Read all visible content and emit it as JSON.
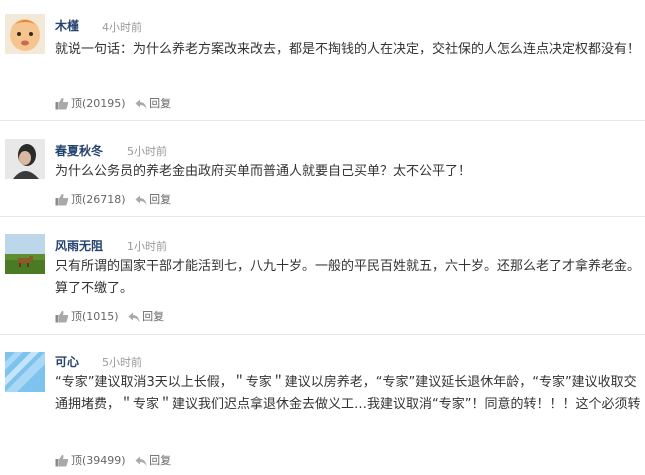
{
  "comments": [
    {
      "username": "木槿",
      "time": "4小时前",
      "text": "就说一句话：为什么养老方案改来改去，都是不掏钱的人在决定，交社保的人怎么连点决定权都没有！",
      "like_label": "顶",
      "like_count": "(20195)",
      "reply_label": "回复",
      "avatar_icon": "baby-face-avatar"
    },
    {
      "username": "春夏秋冬",
      "time": "5小时前",
      "text": "为什么公务员的养老金由政府买单而普通人就要自己买单？太不公平了！",
      "like_label": "顶",
      "like_count": "(26718)",
      "reply_label": "回复",
      "avatar_icon": "woman-photo-avatar"
    },
    {
      "username": "风雨无阻",
      "time": "1小时前",
      "text": "只有所谓的国家干部才能活到七，八九十岁。一般的平民百姓就五，六十岁。还那么老了才拿养老金。算了不缴了。",
      "like_label": "顶",
      "like_count": "(1015)",
      "reply_label": "回复",
      "avatar_icon": "landscape-cow-avatar"
    },
    {
      "username": "可心",
      "time": "5小时前",
      "text": "“专家”建议取消3天以上长假，＂专家＂建议以房养老，“专家”建议延长退休年龄，“专家”建议收取交通拥堵费，＂专家＂建议我们迟点拿退休金去做义工…我建议取消“专家”！同意的转！！！这个必须转",
      "like_label": "顶",
      "like_count": "(39499)",
      "reply_label": "回复",
      "avatar_icon": "sunburst-avatar"
    }
  ],
  "colors": {
    "username": "#24426e",
    "time": "#999999",
    "text": "#333333",
    "divider": "#e6e6e6"
  }
}
